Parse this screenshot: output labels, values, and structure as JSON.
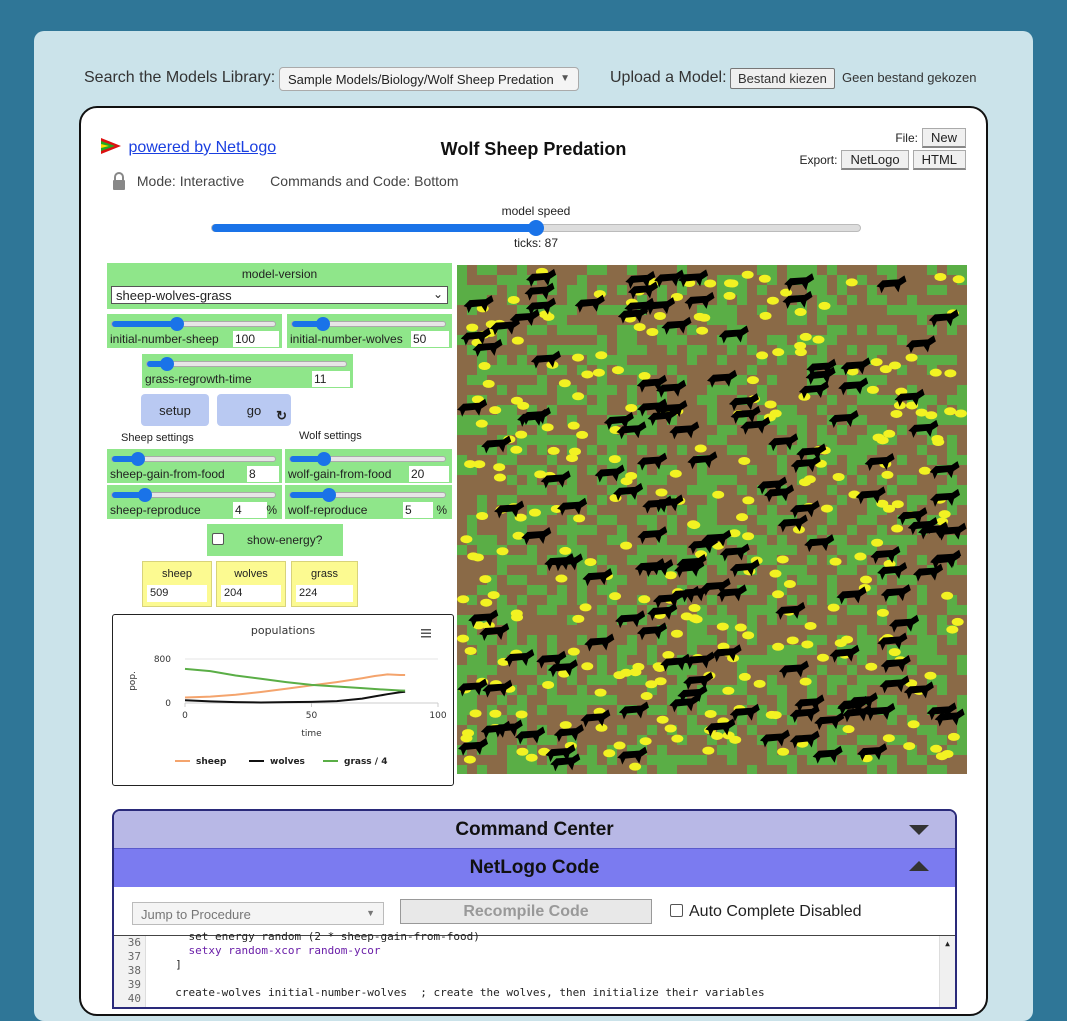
{
  "top": {
    "search_label": "Search the Models Library:",
    "search_value": "Sample Models/Biology/Wolf Sheep Predation",
    "upload_label": "Upload a Model:",
    "choose_file": "Bestand kiezen",
    "no_file": "Geen bestand gekozen"
  },
  "header": {
    "powered": "powered by NetLogo",
    "title": "Wolf Sheep Predation",
    "file_label": "File:",
    "new_btn": "New",
    "export_label": "Export:",
    "netlogo_btn": "NetLogo",
    "html_btn": "HTML",
    "mode": "Mode: Interactive",
    "commands_code": "Commands and Code: Bottom"
  },
  "speed": {
    "label": "model speed",
    "ticks": "ticks: 87",
    "value": 0.5
  },
  "widgets": {
    "model_version": {
      "label": "model-version",
      "value": "sheep-wolves-grass"
    },
    "initial_number_sheep": {
      "name": "initial-number-sheep",
      "value": "100",
      "fraction": 0.4
    },
    "initial_number_wolves": {
      "name": "initial-number-wolves",
      "value": "50",
      "fraction": 0.2
    },
    "grass_regrowth_time": {
      "name": "grass-regrowth-time",
      "value": "11",
      "fraction": 0.1
    },
    "setup": "setup",
    "go": "go",
    "sheep_settings": "Sheep settings",
    "wolf_settings": "Wolf settings",
    "sheep_gain_from_food": {
      "name": "sheep-gain-from-food",
      "value": "8",
      "fraction": 0.16
    },
    "wolf_gain_from_food": {
      "name": "wolf-gain-from-food",
      "value": "20",
      "fraction": 0.22
    },
    "sheep_reproduce": {
      "name": "sheep-reproduce",
      "value": "4",
      "unit": "%",
      "fraction": 0.2
    },
    "wolf_reproduce": {
      "name": "wolf-reproduce",
      "value": "5",
      "unit": "%",
      "fraction": 0.25
    },
    "show_energy": "show-energy?",
    "monitors": [
      {
        "label": "sheep",
        "value": "509"
      },
      {
        "label": "wolves",
        "value": "204"
      },
      {
        "label": "grass",
        "value": "224"
      }
    ]
  },
  "chart_data": {
    "type": "line",
    "title": "populations",
    "xlabel": "time",
    "ylabel": "pop.",
    "xlim": [
      0,
      100
    ],
    "ylim": [
      0,
      800
    ],
    "x_ticks": [
      "0",
      "50",
      "100"
    ],
    "y_ticks": [
      "0",
      "800"
    ],
    "series": [
      {
        "name": "sheep",
        "color": "#f4a46d",
        "x": [
          0,
          10,
          20,
          30,
          40,
          50,
          60,
          70,
          75,
          80,
          85,
          87
        ],
        "y": [
          100,
          115,
          150,
          200,
          260,
          320,
          380,
          450,
          490,
          520,
          510,
          509
        ]
      },
      {
        "name": "wolves",
        "color": "#111111",
        "x": [
          0,
          10,
          20,
          30,
          40,
          50,
          60,
          70,
          75,
          80,
          85,
          87
        ],
        "y": [
          50,
          30,
          15,
          10,
          15,
          20,
          35,
          80,
          120,
          160,
          195,
          204
        ]
      },
      {
        "name": "grass / 4",
        "color": "#5aae46",
        "x": [
          0,
          10,
          20,
          30,
          40,
          50,
          60,
          70,
          75,
          80,
          85,
          87
        ],
        "y": [
          620,
          580,
          500,
          440,
          380,
          330,
          300,
          270,
          255,
          240,
          228,
          224
        ]
      }
    ],
    "legend_position": "bottom"
  },
  "panel": {
    "command_center": "Command Center",
    "netlogo_code": "NetLogo Code",
    "jump": "Jump to Procedure",
    "recompile": "Recompile Code",
    "auto_complete": "Auto Complete Disabled",
    "code_lines": [
      {
        "n": "36",
        "text": "    set energy random (2 * sheep-gain-from-food)"
      },
      {
        "n": "37",
        "text": "    setxy random-xcor random-ycor"
      },
      {
        "n": "38",
        "text": "  ]"
      },
      {
        "n": "39",
        "text": ""
      },
      {
        "n": "40",
        "text": "  create-wolves initial-number-wolves  ; create the wolves, then initialize their variables"
      }
    ]
  },
  "colors": {
    "page_bg": "#2f7697",
    "outer_bg": "#cbe3ea",
    "widget_green": "#8fe68a",
    "button_blue": "#b9c9f2",
    "monitor_yellow": "#fcfa91",
    "accent": "#1a73e8",
    "dirt": "#8a6a47",
    "grass": "#5aae46",
    "sheep_agent": "#f2f222",
    "wolf_agent": "#000000"
  }
}
